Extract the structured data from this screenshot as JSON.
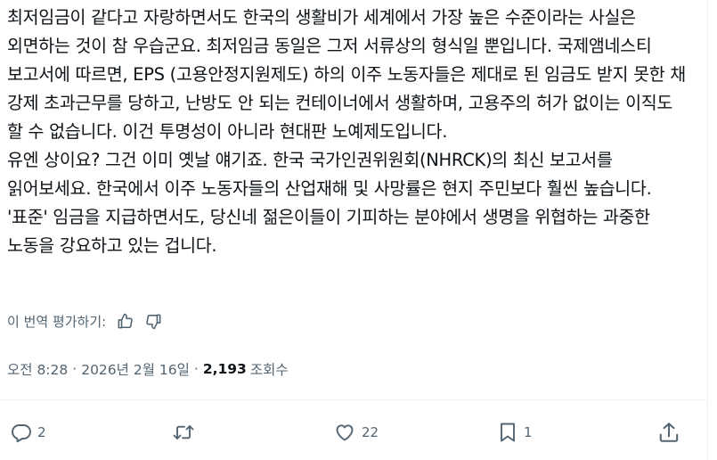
{
  "tweet": {
    "paragraphs": [
      "최저임금이 같다고 자랑하면서도 한국의 생활비가 세계에서 가장 높은 수준이라는 사실은 외면하는 것이 참 우습군요. 최저임금 동일은 그저 서류상의 형식일 뿐입니다. 국제앰네스티 보고서에 따르면, EPS (고용안정지원제도) 하의 이주 노동자들은 제대로 된 임금도 받지 못한 채 강제 초과근무를 당하고, 난방도 안 되는 컨테이너에서 생활하며, 고용주의 허가 없이는 이직도 할 수 없습니다. 이건 투명성이 아니라 현대판 노예제도입니다.",
      "유엔 상이요? 그건 이미 옛날 얘기죠. 한국 국가인권위원회(NHRCK)의 최신 보고서를 읽어보세요. 한국에서 이주 노동자들의 산업재해 및 사망률은 현지 주민보다 훨씬 높습니다. '표준' 임금을 지급하면서도, 당신네 젊은이들이 기피하는 분야에서 생명을 위협하는 과중한 노동을 강요하고 있는 겁니다."
    ]
  },
  "translation_rating": {
    "label": "이 번역 평가하기:",
    "thumbs_up_icon": "thumbs-up-icon",
    "thumbs_down_icon": "thumbs-down-icon"
  },
  "meta": {
    "time": "오전 8:28",
    "separator": "·",
    "date": "2026년 2월 16일",
    "views": "2,193",
    "views_label": "조회수"
  },
  "actions": {
    "reply": {
      "icon": "reply-icon",
      "count": "2"
    },
    "repost": {
      "icon": "repost-icon",
      "count": ""
    },
    "like": {
      "icon": "heart-icon",
      "count": "22"
    },
    "bookmark": {
      "icon": "bookmark-icon",
      "count": "1"
    },
    "share": {
      "icon": "share-icon",
      "count": ""
    }
  },
  "colors": {
    "text": "#0f1419",
    "secondary": "#536471",
    "border": "#eff3f4"
  }
}
